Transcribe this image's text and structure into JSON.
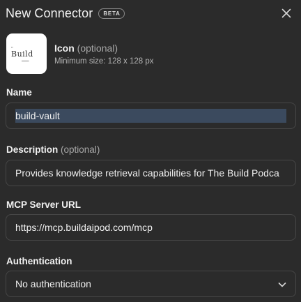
{
  "header": {
    "title": "New Connector",
    "badge": "BETA"
  },
  "icon_section": {
    "label": "Icon",
    "optional": "(optional)",
    "hint": "Minimum size: 128 x 128 px",
    "preview_text": "Build"
  },
  "fields": {
    "name": {
      "label": "Name",
      "value": "build-vault"
    },
    "description": {
      "label": "Description",
      "optional": "(optional)",
      "value": "Provides knowledge retrieval capabilities for The Build Podca"
    },
    "url": {
      "label": "MCP Server URL",
      "value": "https://mcp.buildaipod.com/mcp"
    },
    "auth": {
      "label": "Authentication",
      "value": "No authentication"
    }
  },
  "colors": {
    "background": "#2b2b2b",
    "border": "#474747",
    "selection": "#3b4a5e"
  }
}
